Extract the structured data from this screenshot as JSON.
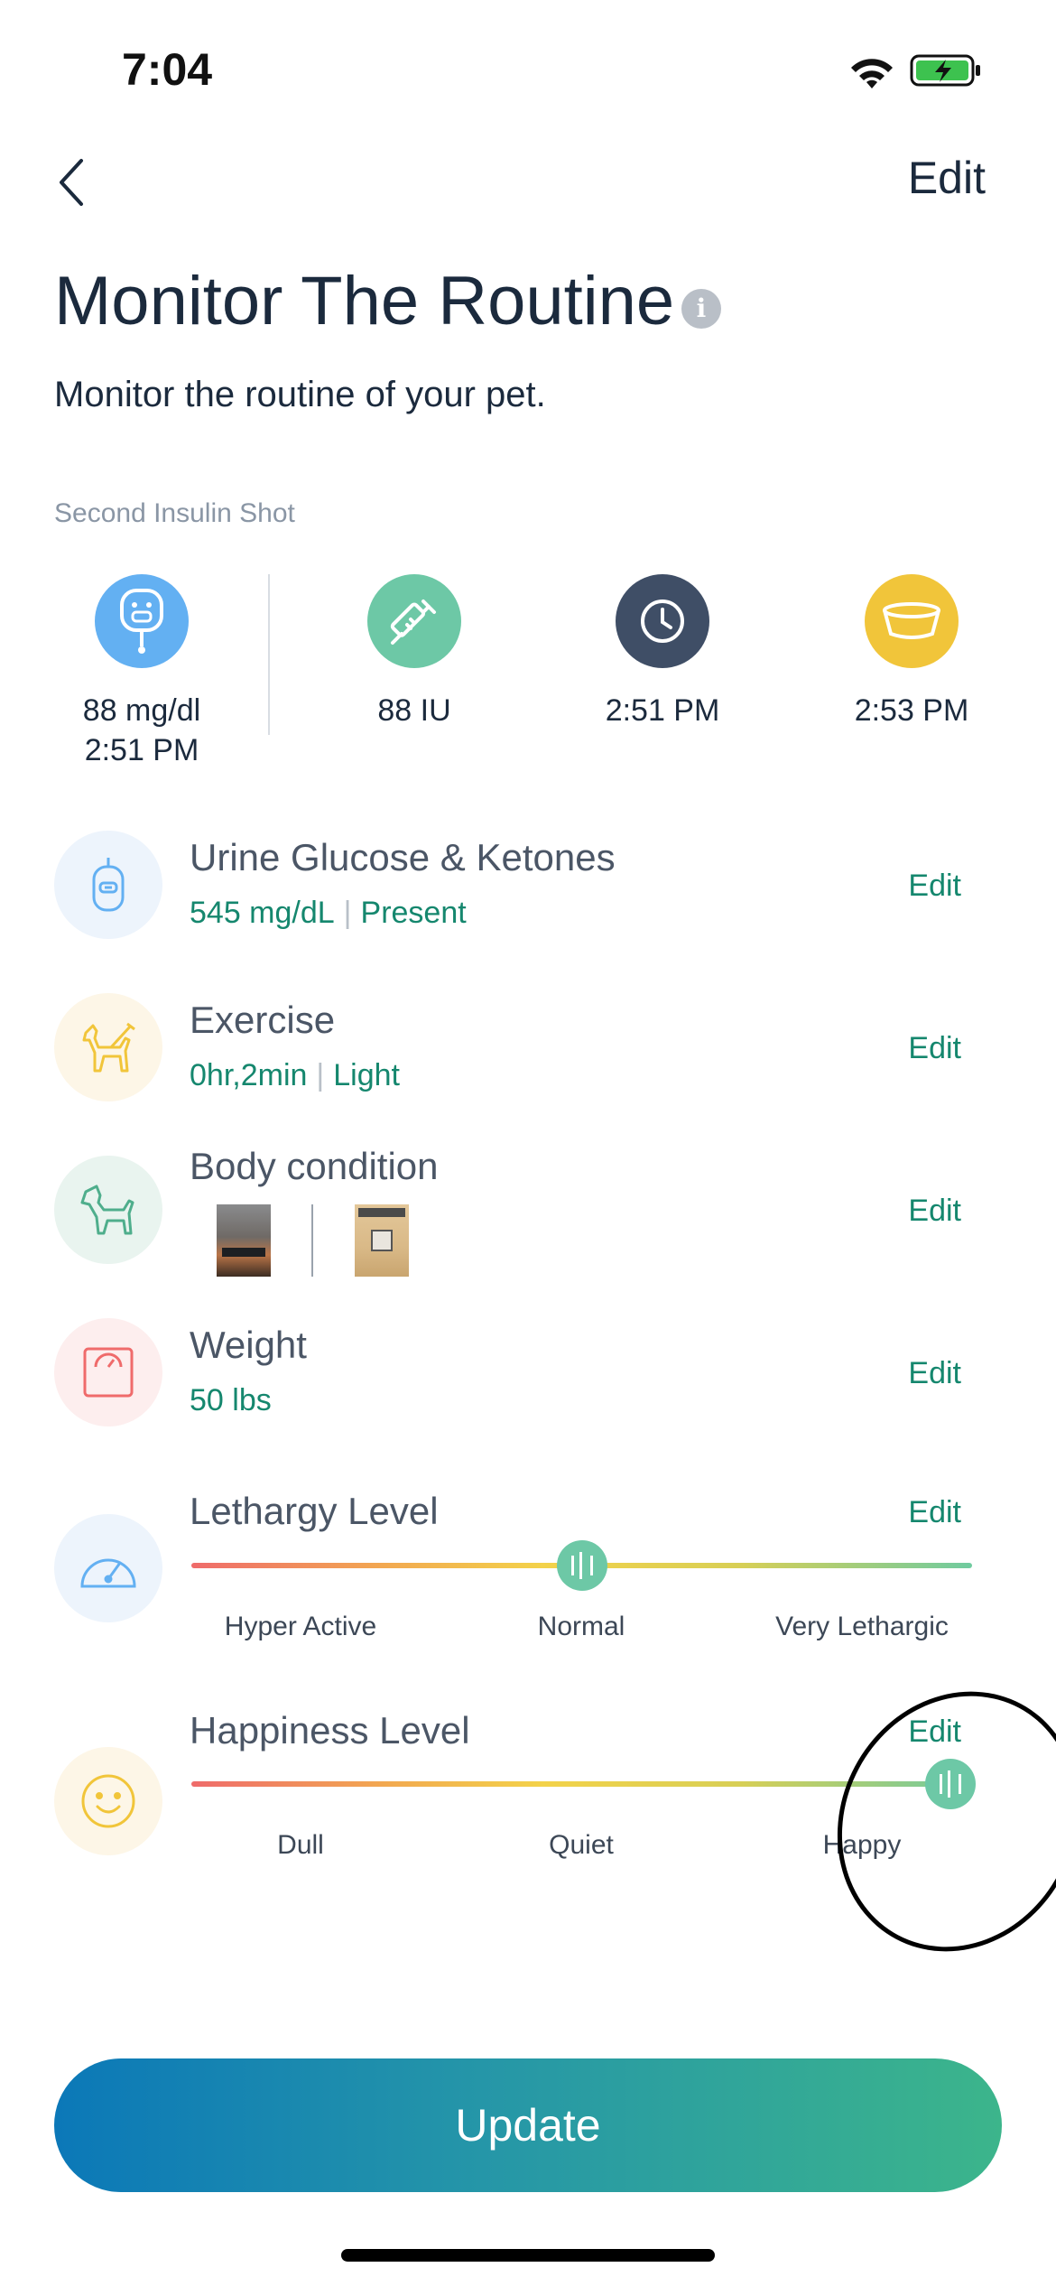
{
  "status_bar": {
    "time": "7:04"
  },
  "header": {
    "edit_label": "Edit",
    "title": "Monitor The Routine",
    "info_glyph": "i",
    "subtitle": "Monitor the routine of your pet."
  },
  "summary": {
    "section_label": "Second Insulin Shot",
    "items": [
      {
        "icon": "glucose-meter-icon",
        "line1": "88 mg/dl",
        "line2": "2:51 PM",
        "color": "#63b0f2"
      },
      {
        "icon": "syringe-icon",
        "line1": "88 IU",
        "color": "#6dc8a6"
      },
      {
        "icon": "clock-icon",
        "line1": "2:51 PM",
        "color": "#3f4e66"
      },
      {
        "icon": "food-bowl-icon",
        "line1": "2:53 PM",
        "color": "#f1c53a"
      }
    ]
  },
  "rows": [
    {
      "icon": "urine-test-icon",
      "title": "Urine Glucose & Ketones",
      "value1": "545 mg/dL",
      "value2": "Present",
      "edit": "Edit"
    },
    {
      "icon": "exercise-dog-icon",
      "title": "Exercise",
      "value1": "0hr,2min",
      "value2": "Light",
      "edit": "Edit"
    },
    {
      "icon": "dog-icon",
      "title": "Body condition",
      "edit": "Edit"
    },
    {
      "icon": "scale-icon",
      "title": "Weight",
      "value1": "50 lbs",
      "edit": "Edit"
    }
  ],
  "lethargy": {
    "title": "Lethargy Level",
    "edit": "Edit",
    "labels": [
      "Hyper Active",
      "Normal",
      "Very Lethargic"
    ],
    "value_fraction": 0.5
  },
  "happiness": {
    "title": "Happiness Level",
    "edit": "Edit",
    "labels": [
      "Dull",
      "Quiet",
      "Happy"
    ],
    "value_fraction": 1.0
  },
  "update_button": {
    "label": "Update"
  },
  "colors": {
    "accent": "#15876e",
    "button_start": "#0b78b8",
    "button_end": "#3cb58b"
  }
}
